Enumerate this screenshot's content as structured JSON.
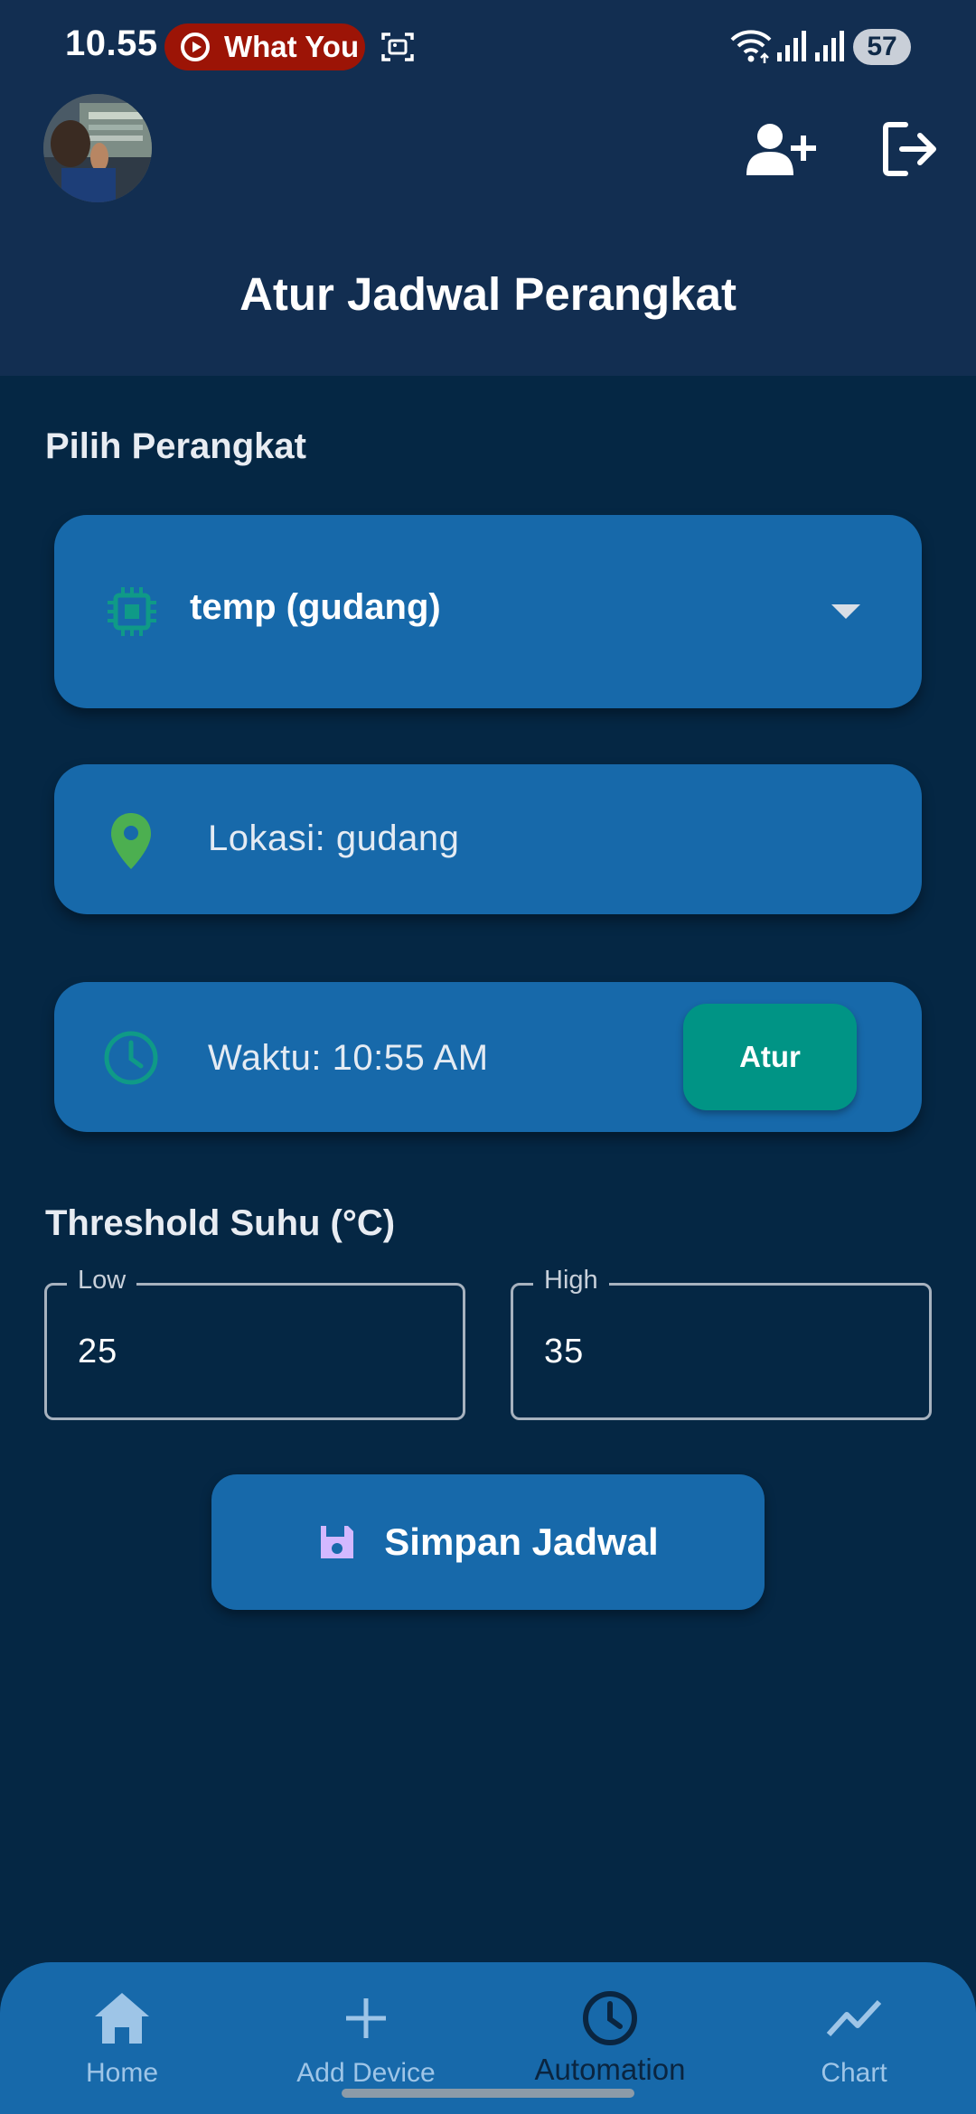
{
  "status_bar": {
    "time": "10.55",
    "media_pill_text": "What You",
    "battery_level": "57"
  },
  "header": {
    "title": "Atur Jadwal Perangkat"
  },
  "device_section": {
    "label": "Pilih Perangkat",
    "selected_device": "temp (gudang)",
    "location_text": "Lokasi: gudang",
    "time_text": "Waktu: 10:55 AM",
    "set_time_button": "Atur"
  },
  "threshold_section": {
    "label": "Threshold Suhu (°C)",
    "low": {
      "label": "Low",
      "value": "25"
    },
    "high": {
      "label": "High",
      "value": "35"
    }
  },
  "save_button_label": "Simpan Jadwal",
  "bottom_nav": {
    "items": [
      {
        "label": "Home",
        "icon": "home-icon"
      },
      {
        "label": "Add Device",
        "icon": "plus-icon"
      },
      {
        "label": "Automation",
        "icon": "clock-icon",
        "active": true
      },
      {
        "label": "Chart",
        "icon": "trend-icon"
      }
    ]
  },
  "colors": {
    "background": "#052744",
    "header": "#122e51",
    "card": "#1769aa",
    "accent_teal": "#009485",
    "pin_green": "#4caf50",
    "save_icon": "#d3b8ff"
  }
}
